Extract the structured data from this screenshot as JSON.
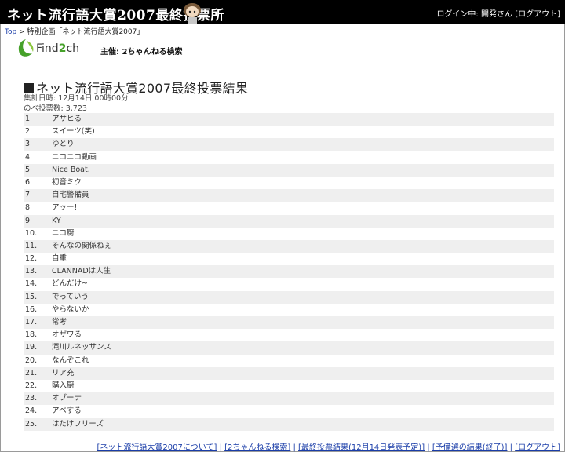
{
  "header": {
    "title": "ネット流行語大賞2007最終投票所",
    "login_status": "ログイン中: 開発さん",
    "logout_link": "[ログアウト]"
  },
  "breadcrumb": {
    "top": "Top",
    "separator": " > ",
    "current": "特別企画「ネット流行語大賞2007」"
  },
  "logo": {
    "text_find": "Find",
    "text_two": "2",
    "text_ch": "ch",
    "sponsor": "主催: 2ちゃんねる検索",
    "brand_color": "#46a12a"
  },
  "results": {
    "title": "ネット流行語大賞2007最終投票結果",
    "tally_date": "集計日時: 12月14日 00時00分",
    "total_votes": "のべ投票数: 3,723",
    "items": [
      {
        "rank": "1.",
        "name": "アサヒる"
      },
      {
        "rank": "2.",
        "name": "スイーツ(笑)"
      },
      {
        "rank": "3.",
        "name": "ゆとり"
      },
      {
        "rank": "4.",
        "name": "ニコニコ動画"
      },
      {
        "rank": "5.",
        "name": "Nice Boat."
      },
      {
        "rank": "6.",
        "name": "初音ミク"
      },
      {
        "rank": "7.",
        "name": "自宅警備員"
      },
      {
        "rank": "8.",
        "name": "アッー!"
      },
      {
        "rank": "9.",
        "name": "KY"
      },
      {
        "rank": "10.",
        "name": "ニコ厨"
      },
      {
        "rank": "11.",
        "name": "そんなの関係ねぇ"
      },
      {
        "rank": "12.",
        "name": "自重"
      },
      {
        "rank": "13.",
        "name": "CLANNADは人生"
      },
      {
        "rank": "14.",
        "name": "どんだけ~"
      },
      {
        "rank": "15.",
        "name": "でっていう"
      },
      {
        "rank": "16.",
        "name": "やらないか"
      },
      {
        "rank": "17.",
        "name": "常考"
      },
      {
        "rank": "18.",
        "name": "オザワる"
      },
      {
        "rank": "19.",
        "name": "滝川ルネッサンス"
      },
      {
        "rank": "20.",
        "name": "なんぞこれ"
      },
      {
        "rank": "21.",
        "name": "リア充"
      },
      {
        "rank": "22.",
        "name": "購入厨"
      },
      {
        "rank": "23.",
        "name": "オブーナ"
      },
      {
        "rank": "24.",
        "name": "アベする"
      },
      {
        "rank": "25.",
        "name": "はたけフリーズ"
      }
    ]
  },
  "footer": {
    "links": [
      "[ネット流行語大賞2007について]",
      "[2ちゃんねる検索]",
      "[最終投票結果(12月14日発表予定)]",
      "[予備選の結果(終了)]",
      "[ログアウト]"
    ],
    "separator": " | "
  }
}
